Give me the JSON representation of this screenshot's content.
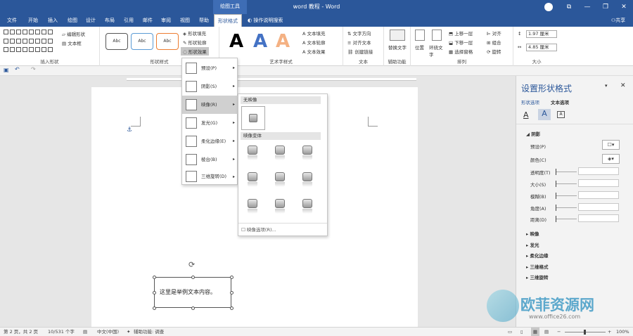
{
  "titlebar": {
    "context_tab": "绘图工具",
    "title": "word 教程  -  Word",
    "btn_ribbon": "⧉",
    "btn_min": "—",
    "btn_max": "❐",
    "btn_close": "✕"
  },
  "tabs": [
    "文件",
    "开始",
    "插入",
    "绘图",
    "设计",
    "布局",
    "引用",
    "邮件",
    "审阅",
    "视图",
    "帮助",
    "形状格式"
  ],
  "tell_me": "操作说明搜索",
  "share": "共享",
  "ribbon": {
    "insert_shapes": {
      "edit_shape": "编辑形状",
      "text_box": "文本框",
      "label": "插入形状"
    },
    "shape_styles": {
      "samples": [
        "Abc",
        "Abc",
        "Abc"
      ],
      "fill": "形状填充",
      "outline": "形状轮廓",
      "effects": "形状效果",
      "label": "形状样式"
    },
    "wordart": {
      "letters": [
        "A",
        "A",
        "A"
      ],
      "text_fill": "文本填充",
      "text_outline": "文本轮廓",
      "text_effect": "文本效果",
      "label": "艺术字样式"
    },
    "text": {
      "direction": "文字方向",
      "align": "对齐文本",
      "link": "创建链接",
      "label": "文本"
    },
    "accessibility": {
      "alt": "替换文字",
      "label": "辅助功能"
    },
    "arrange": {
      "position": "位置",
      "wrap": "环绕文字",
      "forward": "上移一层",
      "backward": "下移一层",
      "pane": "选择窗格",
      "align": "对齐",
      "group": "组合",
      "rotate": "旋转",
      "label": "排列"
    },
    "size": {
      "height": "1.97 厘米",
      "width": "4.85 厘米",
      "label": "大小"
    }
  },
  "document": {
    "sample_text": "这里是举例文本内容。"
  },
  "effects_menu": [
    {
      "label": "预设(P)"
    },
    {
      "label": "阴影(S)"
    },
    {
      "label": "映像(R)"
    },
    {
      "label": "发光(G)"
    },
    {
      "label": "柔化边缘(E)"
    },
    {
      "label": "棱台(B)"
    },
    {
      "label": "三维旋转(D)"
    }
  ],
  "reflection_submenu": {
    "none_header": "无映像",
    "variants_header": "映像变体",
    "options": "映像选项(R)..."
  },
  "panel": {
    "title": "设置形状格式",
    "tab_shape": "形状选项",
    "tab_text": "文本选项",
    "shadow_section": "阴影",
    "rows": [
      "预设(P)",
      "颜色(C)",
      "透明度(T)",
      "大小(S)",
      "模糊(B)",
      "角度(A)",
      "距离(D)"
    ],
    "sections": [
      "映像",
      "发光",
      "柔化边缘",
      "三维格式",
      "三维旋转"
    ]
  },
  "status": {
    "page": "第 2 页，共 2 页",
    "words": "10/531 个字",
    "lang": "中文(中国)",
    "access": "辅助功能: 调查",
    "zoom": "100%"
  },
  "watermark": {
    "brand": "欧菲资源网",
    "url": "www.office26.com"
  },
  "colors": {
    "accent": "#2b579a",
    "ribbon_bg": "#ffffff",
    "menu_highlight": "#d0d0d0"
  }
}
